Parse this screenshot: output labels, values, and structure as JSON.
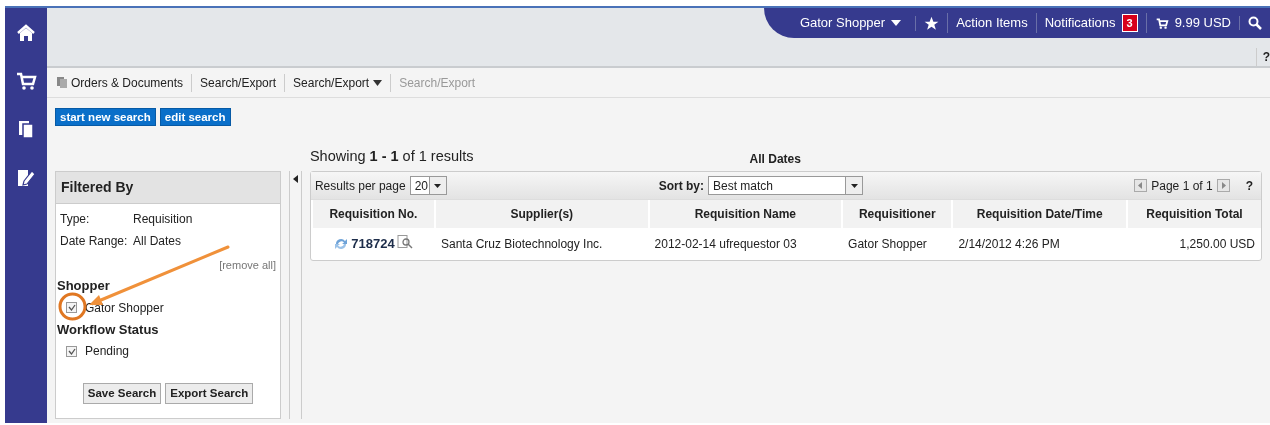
{
  "top_nav": {
    "user": "Gator Shopper",
    "action_items": "Action Items",
    "notifications": "Notifications",
    "notification_count": "3",
    "cart_total": "9.99 USD",
    "help": "?"
  },
  "breadcrumb": [
    {
      "label": "Orders & Documents",
      "kind": "root"
    },
    {
      "label": "Search/Export",
      "kind": "link"
    },
    {
      "label": "Search/Export",
      "kind": "dropdown"
    },
    {
      "label": "Search/Export",
      "kind": "current"
    }
  ],
  "search_buttons": [
    "start new search",
    "edit search"
  ],
  "filter_panel": {
    "title": "Filtered By",
    "criteria": [
      {
        "label": "Type:",
        "value": "Requisition"
      },
      {
        "label": "Date Range:",
        "value": "All Dates"
      }
    ],
    "remove_all": "[remove all]",
    "groups": [
      {
        "title": "Shopper",
        "options": [
          {
            "label": "Gator Shopper",
            "checked": true
          }
        ]
      },
      {
        "title": "Workflow Status",
        "options": [
          {
            "label": "Pending",
            "checked": true
          }
        ]
      }
    ],
    "buttons": [
      "Save Search",
      "Export Search"
    ]
  },
  "results": {
    "showing": "Showing **1 - 1** of 1 results",
    "date_filter": "All Dates",
    "per_page_label": "Results per page",
    "per_page": "20",
    "sort_label": "Sort by:",
    "sort": "Best match",
    "pager": "Page 1 of 1",
    "help": "?",
    "table": {
      "columns": [
        "Requisition No.",
        "Supplier(s)",
        "Requisition Name",
        "Requisitioner",
        "Requisition Date/Time",
        "Requisition Total"
      ],
      "rows": [
        [
          "718724",
          "Santa Cruz Biotechnology Inc.",
          "2012-02-14 ufrequestor 03",
          "Gator Shopper",
          "2/14/2012 4:26 PM",
          "1,250.00 USD"
        ]
      ]
    }
  }
}
